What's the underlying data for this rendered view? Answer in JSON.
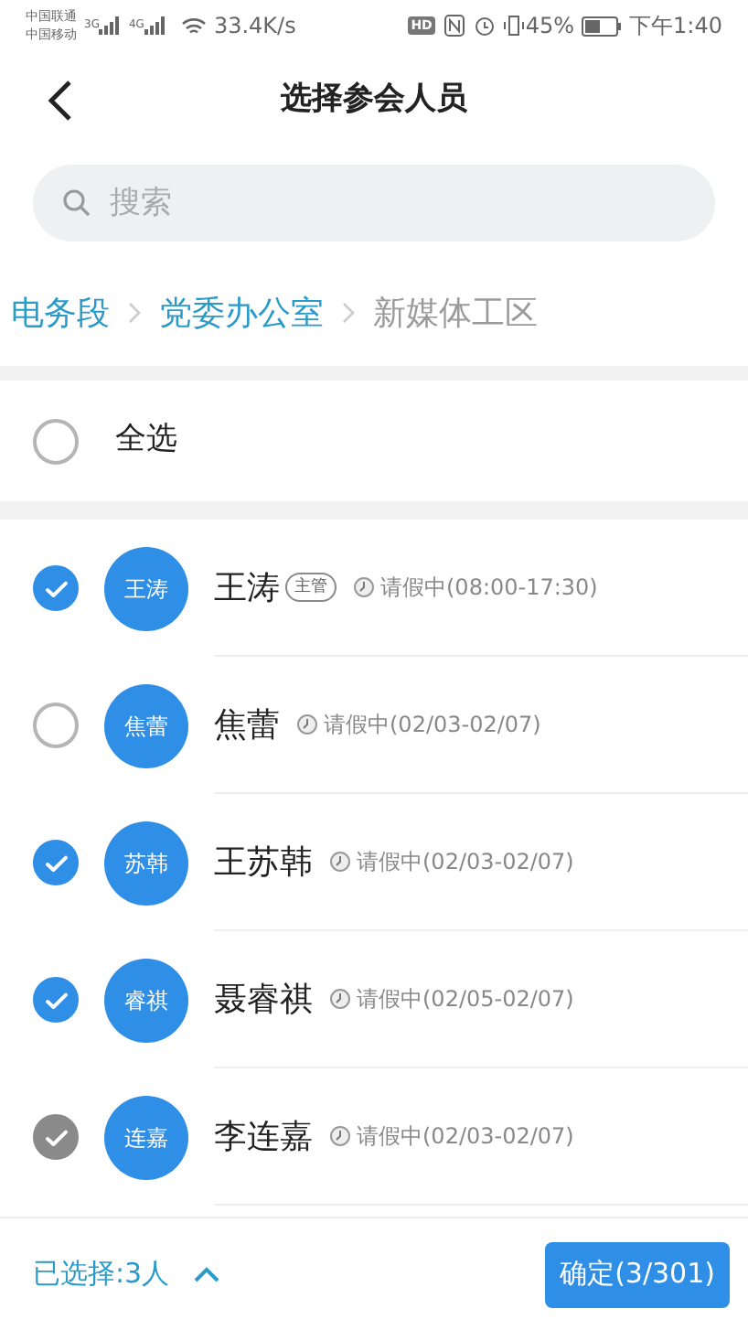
{
  "status_bar": {
    "carriers": [
      "中国联通",
      "中国移动"
    ],
    "network_types": [
      "3G",
      "4G"
    ],
    "speed": "33.4K/s",
    "hd_badge": "HD",
    "battery": "45%",
    "time": "下午1:40"
  },
  "header": {
    "title": "选择参会人员"
  },
  "search": {
    "placeholder": "搜索"
  },
  "breadcrumb": [
    {
      "label": "电务段",
      "selected": false
    },
    {
      "label": "党委办公室",
      "selected": false
    },
    {
      "label": "新媒体工区",
      "selected": true
    }
  ],
  "select_all": {
    "label": "全选",
    "checked": false
  },
  "people": [
    {
      "avatar": "王涛",
      "name": "王涛",
      "tag": "主管",
      "status": "请假中(08:00-17:30)",
      "checked": true,
      "disabled": false
    },
    {
      "avatar": "焦蕾",
      "name": "焦蕾",
      "status": "请假中(02/03-02/07)",
      "checked": false,
      "disabled": false
    },
    {
      "avatar": "苏韩",
      "name": "王苏韩",
      "status": "请假中(02/03-02/07)",
      "checked": true,
      "disabled": false
    },
    {
      "avatar": "睿祺",
      "name": "聂睿祺",
      "status": "请假中(02/05-02/07)",
      "checked": true,
      "disabled": false
    },
    {
      "avatar": "连嘉",
      "name": "李连嘉",
      "status": "请假中(02/03-02/07)",
      "checked": true,
      "disabled": true
    }
  ],
  "footer": {
    "selected_count": "已选择:3人",
    "confirm": "确定(3/301)"
  }
}
